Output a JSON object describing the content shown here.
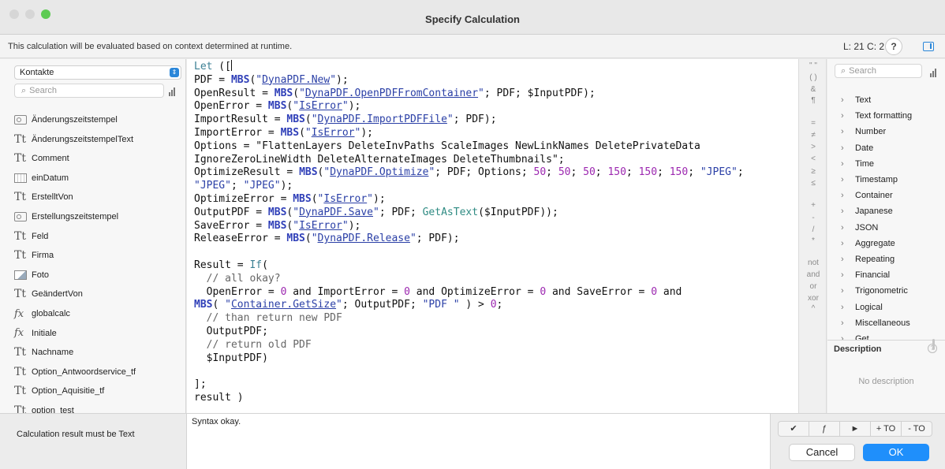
{
  "window": {
    "title": "Specify Calculation",
    "context_text": "This calculation will be evaluated based on context determined at runtime.",
    "line_col": "L: 21 C: 2",
    "help_label": "?"
  },
  "field_panel": {
    "table": "Kontakte",
    "search_placeholder": "Search",
    "fields": [
      {
        "name": "Änderungszeitstempel",
        "type": "timestamp"
      },
      {
        "name": "ÄnderungszeitstempelText",
        "type": "text"
      },
      {
        "name": "Comment",
        "type": "text"
      },
      {
        "name": "einDatum",
        "type": "date"
      },
      {
        "name": "ErstelltVon",
        "type": "text"
      },
      {
        "name": "Erstellungszeitstempel",
        "type": "timestamp"
      },
      {
        "name": "Feld",
        "type": "text"
      },
      {
        "name": "Firma",
        "type": "text"
      },
      {
        "name": "Foto",
        "type": "container"
      },
      {
        "name": "GeändertVon",
        "type": "text"
      },
      {
        "name": "globalcalc",
        "type": "calc"
      },
      {
        "name": "Initiale",
        "type": "calc"
      },
      {
        "name": "Nachname",
        "type": "text"
      },
      {
        "name": "Option_Antwoordservice_tf",
        "type": "text"
      },
      {
        "name": "Option_Aquisitie_tf",
        "type": "text"
      },
      {
        "name": "option_test",
        "type": "text"
      }
    ]
  },
  "code_lines": [
    "Let ([",
    "PDF = MBS(\"DynaPDF.New\");",
    "OpenResult = MBS(\"DynaPDF.OpenPDFFromContainer\"; PDF; $InputPDF);",
    "OpenError = MBS(\"IsError\");",
    "ImportResult = MBS(\"DynaPDF.ImportPDFFile\"; PDF);",
    "ImportError = MBS(\"IsError\");",
    "Options = \"FlattenLayers DeleteInvPaths ScaleImages NewLinkNames DeletePrivateData",
    "IgnoreZeroLineWidth DeleteAlternateImages DeleteThumbnails\";",
    "OptimizeResult = MBS(\"DynaPDF.Optimize\"; PDF; Options; 50; 50; 50; 150; 150; 150; \"JPEG\";",
    "\"JPEG\"; \"JPEG\");",
    "OptimizeError = MBS(\"IsError\");",
    "OutputPDF = MBS(\"DynaPDF.Save\"; PDF; GetAsText($InputPDF));",
    "SaveError = MBS(\"IsError\");",
    "ReleaseError = MBS(\"DynaPDF.Release\"; PDF);",
    "",
    "Result = If(",
    "  // all okay?",
    "  OpenError = 0 and ImportError = 0 and OptimizeError = 0 and SaveError = 0 and",
    "MBS( \"Container.GetSize\"; OutputPDF; \"PDF \" ) > 0;",
    "  // than return new PDF",
    "  OutputPDF;",
    "  // return old PDF",
    "  $InputPDF)",
    "",
    "];",
    "result )"
  ],
  "operators": [
    "\" \"",
    "( )",
    "&",
    "¶",
    "=",
    "≠",
    ">",
    "<",
    "≥",
    "≤",
    "+",
    "-",
    "/",
    "*",
    "not",
    "and",
    "or",
    "xor",
    "^"
  ],
  "function_panel": {
    "search_placeholder": "Search",
    "categories": [
      "Text",
      "Text formatting",
      "Number",
      "Date",
      "Time",
      "Timestamp",
      "Container",
      "Japanese",
      "JSON",
      "Aggregate",
      "Repeating",
      "Financial",
      "Trigonometric",
      "Logical",
      "Miscellaneous",
      "Get"
    ]
  },
  "description": {
    "heading": "Description",
    "text": "No description"
  },
  "bottom": {
    "result_type": "Calculation result must be  Text",
    "syntax_status": "Syntax okay.",
    "tools": [
      "✔",
      "ƒ",
      "►",
      "+ TO",
      "- TO"
    ],
    "cancel": "Cancel",
    "ok": "OK"
  },
  "colors": {
    "accent": "#1f8ffb",
    "mbs_keyword": "#2f3fb8",
    "string": "#2a3fa6",
    "number": "#9c27b0"
  }
}
